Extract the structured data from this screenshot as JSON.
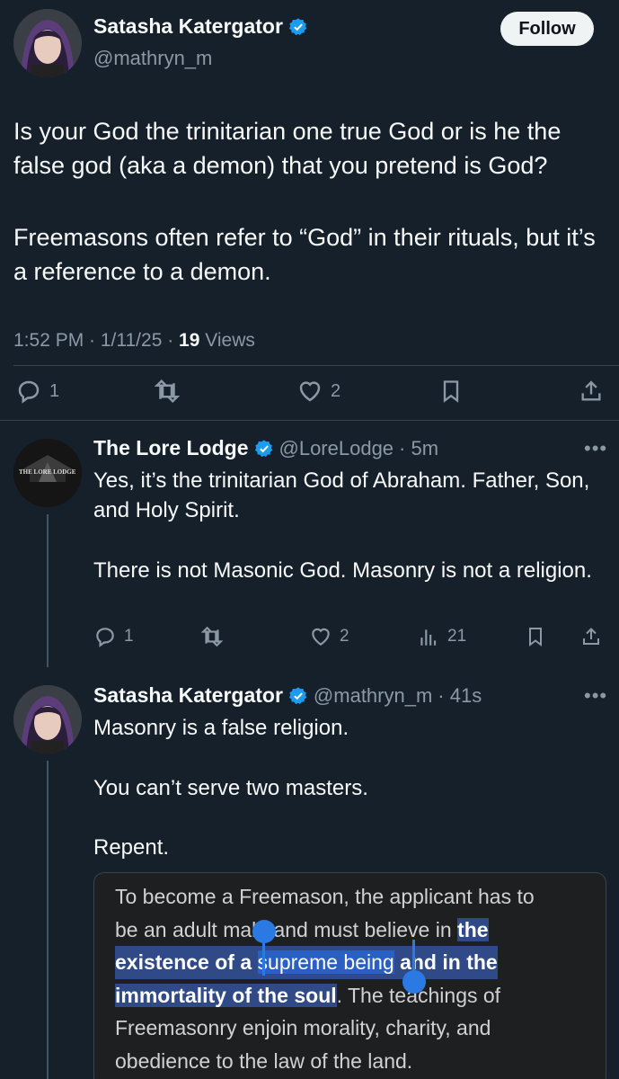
{
  "main_tweet": {
    "author_name": "Satasha Katergator",
    "author_handle": "@mathryn_m",
    "follow_label": "Follow",
    "paragraph1": "Is your God the trinitarian one true God or is he the false god (aka a demon) that you pretend is God?",
    "paragraph2": "Freemasons often refer to “God” in their rituals, but it’s a reference to a demon.",
    "timestamp": "1:52 PM · 1/11/25 · ",
    "views_count": "19",
    "views_label": " Views",
    "replies": "1",
    "likes": "2"
  },
  "reply1": {
    "author_name": "The Lore Lodge",
    "author_handle": "@LoreLodge",
    "time": "· 5m",
    "avatar_text": "THE LORE LODGE",
    "paragraph1": "Yes, it’s the trinitarian God of Abraham. Father, Son, and Holy Spirit.",
    "paragraph2": "There is not Masonic God. Masonry is not a religion.",
    "replies": "1",
    "likes": "2",
    "views": "21"
  },
  "reply2": {
    "author_name": "Satasha Katergator",
    "author_handle": "@mathryn_m",
    "time": "· 41s",
    "line1": "Masonry is a false religion.",
    "line2": "You can’t serve two masters.",
    "line3": "Repent.",
    "quote": {
      "l1": "To become a Freemason, the applicant has to",
      "l2a": "be an adult male and must believe in ",
      "l2b": "the",
      "l3a": "existence of a ",
      "l3b": "supreme being",
      "l3c": " and in the",
      "l4a": "immortality of the soul",
      "l4b": ". The teachings of",
      "l5": "Freemasonry enjoin morality, charity, and",
      "l6": "obedience to the law of the land."
    }
  },
  "colors": {
    "background": "#15202b",
    "verified": "#1d9bf0",
    "highlight": "#2f4a86",
    "selection_handle": "#2b7ae4"
  },
  "icons": [
    "reply-icon",
    "retweet-icon",
    "like-icon",
    "bookmark-icon",
    "share-icon",
    "views-icon",
    "verified-icon",
    "more-icon"
  ]
}
